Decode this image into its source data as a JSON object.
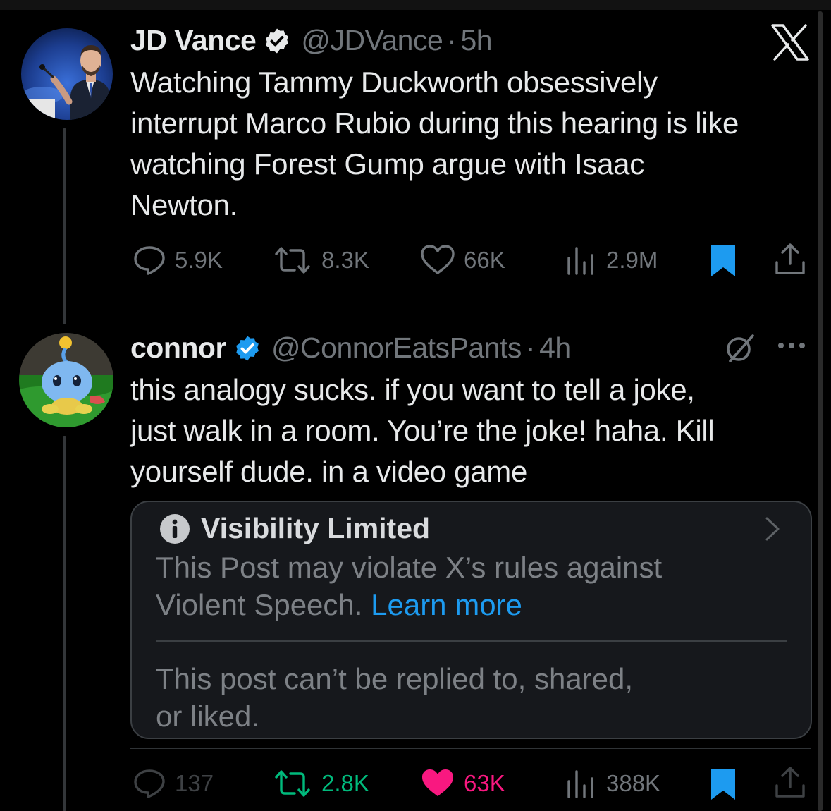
{
  "posts": [
    {
      "name": "JD Vance",
      "handle": "@JDVance",
      "sep": "·",
      "time": "5h",
      "text_lines": [
        "Watching Tammy Duckworth obsessively",
        "interrupt Marco Rubio during this hearing is like",
        "watching Forest Gump argue with Isaac",
        "Newton."
      ],
      "stats": {
        "replies": "5.9K",
        "reposts": "8.3K",
        "likes": "66K",
        "views": "2.9M"
      },
      "bookmarked": true
    },
    {
      "name": "connor",
      "handle": "@ConnorEatsPants",
      "sep": "·",
      "time": "4h",
      "text_lines": [
        "this analogy sucks. if you want to tell a joke,",
        "just walk in a room. You’re the joke! haha. Kill",
        "yourself dude. in a video game"
      ],
      "stats": {
        "replies": "137",
        "reposts": "2.8K",
        "likes": "63K",
        "views": "388K"
      },
      "bookmarked": true,
      "reposted": true,
      "liked": true
    }
  ],
  "notice": {
    "title": "Visibility Limited",
    "line1": "This Post may violate X’s rules against",
    "line2_prefix": "Violent Speech.",
    "link": "Learn more",
    "restriction_line1": "This post can’t be replied to, shared,",
    "restriction_line2": "or liked."
  },
  "icons": [
    "x-logo-icon",
    "verified-icon",
    "reply-icon",
    "repost-icon",
    "like-icon",
    "views-icon",
    "bookmark-icon",
    "share-icon",
    "grok-icon",
    "more-icon",
    "info-icon",
    "chevron-right-icon"
  ],
  "colors": {
    "background": "#000000",
    "text": "#e7e9ea",
    "secondary": "#71767b",
    "accent": "#1d9bf0",
    "repost_active": "#00ba7c",
    "like_active": "#f91880"
  }
}
